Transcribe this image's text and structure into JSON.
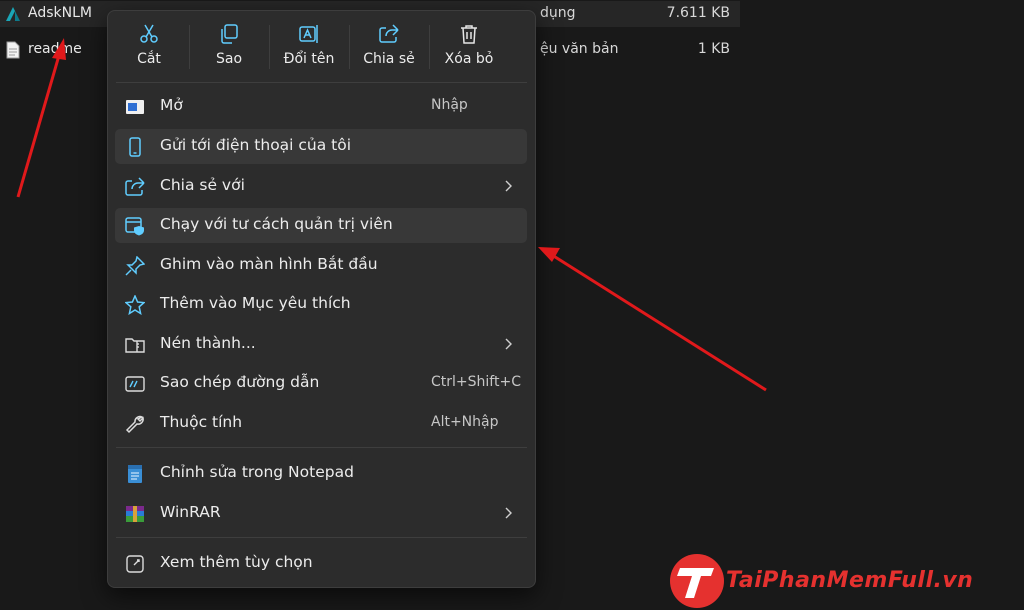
{
  "files": [
    {
      "name": "AdskNLM",
      "type": "dụng",
      "size": "7.611 KB",
      "selected": true
    },
    {
      "name": "readme",
      "type": "ệu văn bản",
      "size": "1 KB",
      "selected": false
    }
  ],
  "quick_actions": [
    {
      "label": "Cắt",
      "icon": "scissors-icon"
    },
    {
      "label": "Sao",
      "icon": "copy-icon"
    },
    {
      "label": "Đổi tên",
      "icon": "rename-icon"
    },
    {
      "label": "Chia sẻ",
      "icon": "share-icon"
    },
    {
      "label": "Xóa bỏ",
      "icon": "trash-icon"
    }
  ],
  "menu_items": [
    {
      "label": "Mở",
      "shortcut": "Nhập",
      "icon": "open-icon"
    },
    {
      "label": "Gửi tới điện thoại của tôi",
      "icon": "phone-icon"
    },
    {
      "label": "Chia sẻ với",
      "icon": "share-with-icon",
      "submenu": true
    },
    {
      "label": "Chạy với tư cách quản trị viên",
      "icon": "admin-shield-icon"
    },
    {
      "label": "Ghim vào màn hình Bắt đầu",
      "icon": "pin-icon"
    },
    {
      "label": "Thêm vào Mục yêu thích",
      "icon": "star-icon"
    },
    {
      "label": "Nén thành...",
      "icon": "zip-icon",
      "submenu": true
    },
    {
      "label": "Sao chép đường dẫn",
      "shortcut": "Ctrl+Shift+C",
      "icon": "copy-path-icon"
    },
    {
      "label": "Thuộc tính",
      "shortcut": "Alt+Nhập",
      "icon": "wrench-icon"
    },
    {
      "label": "Chỉnh sửa trong Notepad",
      "icon": "notepad-icon"
    },
    {
      "label": "WinRAR",
      "icon": "winrar-icon",
      "submenu": true
    },
    {
      "label": "Xem thêm tùy chọn",
      "icon": "more-options-icon"
    }
  ],
  "watermark": {
    "text": "TaiPhanMemFull.vn"
  },
  "colors": {
    "accent": "#60cdff",
    "arrow": "#e0191b",
    "menu_bg": "#2c2c2c",
    "highlight": "#383838"
  }
}
